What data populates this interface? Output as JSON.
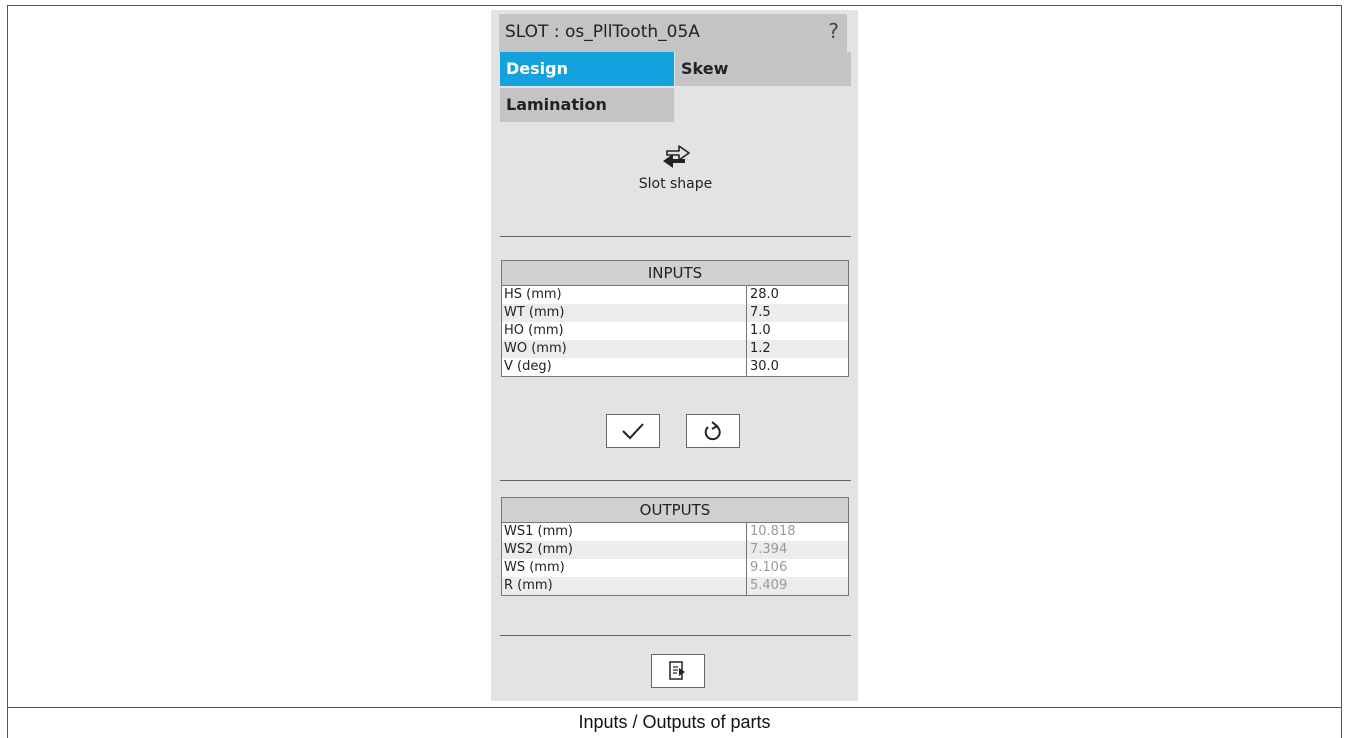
{
  "panel": {
    "title": "SLOT : os_PllTooth_05A",
    "help": "?"
  },
  "tabs": [
    {
      "label": "Design",
      "active": true
    },
    {
      "label": "Skew",
      "active": false
    },
    {
      "label": "Lamination",
      "active": false
    }
  ],
  "slot_shape": {
    "icon": "swap-arrows-icon",
    "label": "Slot shape"
  },
  "inputs": {
    "header": "INPUTS",
    "rows": [
      {
        "label": "HS (mm)",
        "value": "28.0"
      },
      {
        "label": "WT (mm)",
        "value": "7.5"
      },
      {
        "label": "HO (mm)",
        "value": "1.0"
      },
      {
        "label": "WO (mm)",
        "value": "1.2"
      },
      {
        "label": "V (deg)",
        "value": "30.0"
      }
    ]
  },
  "actions": {
    "apply_icon": "checkmark-icon",
    "reset_icon": "refresh-icon",
    "export_icon": "export-document-icon"
  },
  "outputs": {
    "header": "OUTPUTS",
    "rows": [
      {
        "label": "WS1 (mm)",
        "value": "10.818"
      },
      {
        "label": "WS2 (mm)",
        "value": "7.394"
      },
      {
        "label": "WS (mm)",
        "value": "9.106"
      },
      {
        "label": "R (mm)",
        "value": "5.409"
      }
    ]
  },
  "caption": "Inputs / Outputs of parts",
  "colors": {
    "accent": "#13a2de",
    "panel_bg": "#e3e3e3",
    "tab_bg": "#c4c4c4"
  }
}
